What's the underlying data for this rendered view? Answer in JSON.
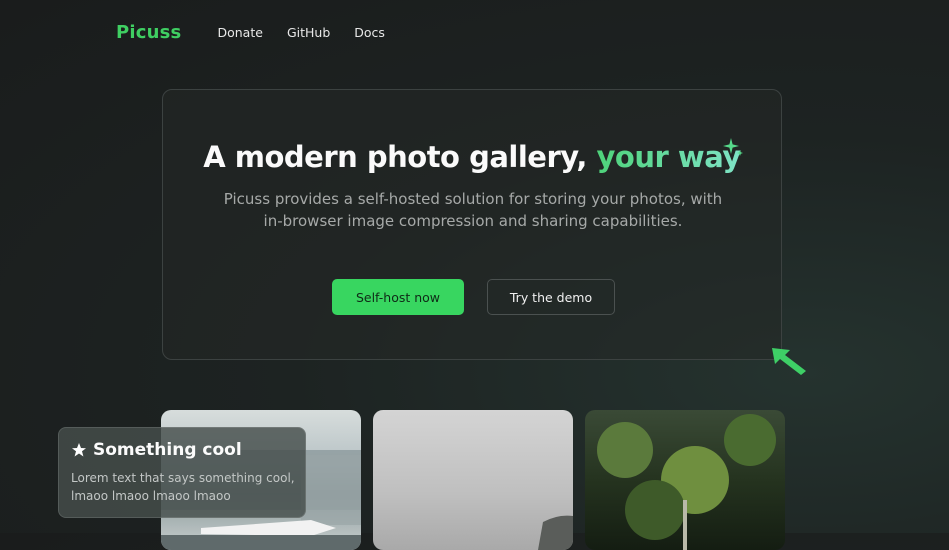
{
  "nav": {
    "logo": "Picuss",
    "links": [
      "Donate",
      "GitHub",
      "Docs"
    ]
  },
  "hero": {
    "title_main": "A modern photo gallery, ",
    "title_accent": "your way",
    "subtitle_line1": "Picuss provides a self-hosted solution for storing your photos, with",
    "subtitle_line2": "in-browser image compression and sharing capabilities.",
    "primary_button": "Self-host now",
    "secondary_button": "Try the demo"
  },
  "tooltip": {
    "icon": "star-icon",
    "title": "Something cool",
    "text": "Lorem text that says something cool, lmaoo lmaoo lmaoo lmaoo"
  },
  "colors": {
    "brand": "#3fcf62",
    "primary_button": "#38d660",
    "background": "#1d2322"
  }
}
